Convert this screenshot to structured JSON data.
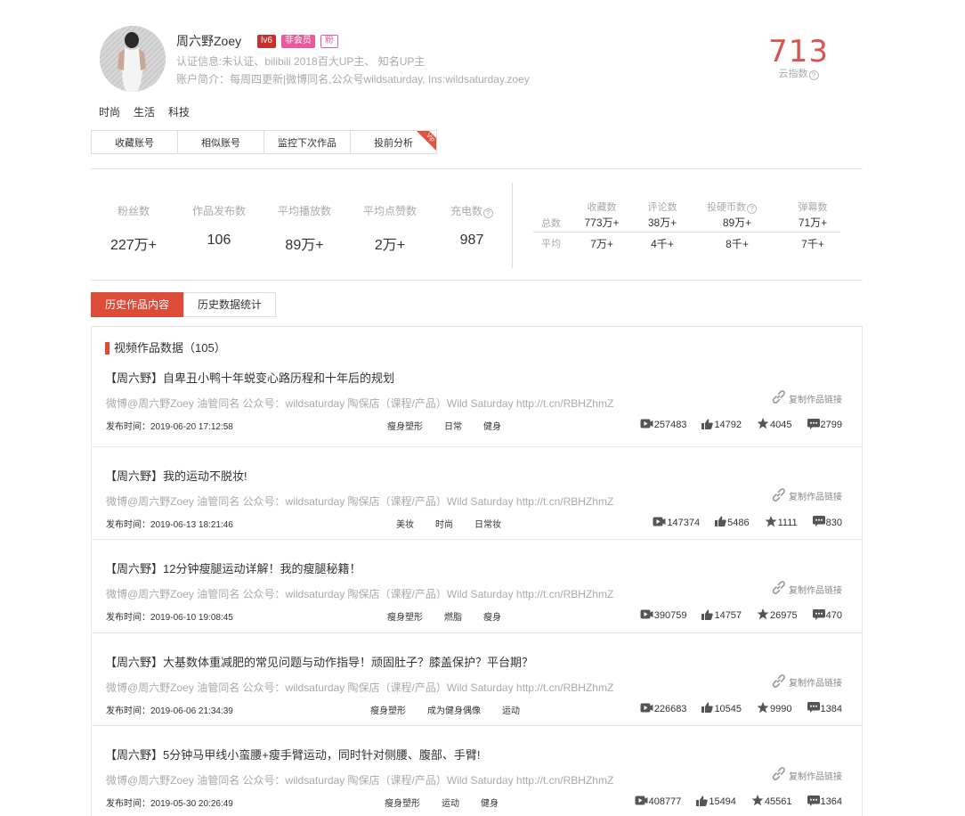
{
  "profile": {
    "name": "周六野Zoey",
    "badges": {
      "level": "lv6",
      "membership": "非会员",
      "fan": "粉"
    },
    "cert_info": "认证信息:未认证、bilibili 2018百大UP主、 知名UP主",
    "intro": "账户简介：每周四更新|微博同名,公众号wildsaturday, Ins:wildsaturday.zoey",
    "score": "713",
    "score_label": "云指数",
    "tags": [
      "时尚",
      "生活",
      "科技"
    ]
  },
  "actions": {
    "collect": "收藏账号",
    "similar": "相似账号",
    "monitor": "监控下次作品",
    "analysis": "投前分析",
    "vip_ribbon": "Vip"
  },
  "stats": {
    "fans": {
      "label": "粉丝数",
      "value": "227万+"
    },
    "works": {
      "label": "作品发布数",
      "value": "106"
    },
    "avg_play": {
      "label": "平均播放数",
      "value": "89万+"
    },
    "avg_like": {
      "label": "平均点赞数",
      "value": "2万+"
    },
    "charge": {
      "label": "充电数",
      "value": "987"
    }
  },
  "stat_grid": {
    "row_total": "总数",
    "row_avg": "平均",
    "headers": [
      "收藏数",
      "评论数",
      "投硬币数",
      "弹幕数"
    ],
    "total": [
      "773万+",
      "38万+",
      "89万+",
      "71万+"
    ],
    "avg": [
      "7万+",
      "4千+",
      "8千+",
      "7千+"
    ]
  },
  "tabs": {
    "history": "历史作品内容",
    "stats": "历史数据统计"
  },
  "list": {
    "title": "视频作品数据（105）",
    "copy_label": "复制作品链接",
    "date_prefix": "发布时间：",
    "items": [
      {
        "title": "【周六野】自卑丑小鸭十年蜕变心路历程和十年后的规划",
        "desc": "微博@周六野Zoey 油管同名 公众号：wildsaturday 陶保店（课程/产品）Wild Saturday http://t.cn/RBHZhmZ",
        "date": "2019-06-20 17:12:58",
        "tags": [
          "瘦身塑形",
          "日常",
          "健身"
        ],
        "plays": "257483",
        "likes": "14792",
        "coins": "4045",
        "comments": "2799"
      },
      {
        "title": "【周六野】我的运动不脱妆!",
        "desc": "微博@周六野Zoey 油管同名 公众号：wildsaturday 陶保店（课程/产品）Wild Saturday http://t.cn/RBHZhmZ",
        "date": "2019-06-13 18:21:46",
        "tags": [
          "美妆",
          "时尚",
          "日常妆"
        ],
        "plays": "147374",
        "likes": "5486",
        "coins": "1111",
        "comments": "830"
      },
      {
        "title": "【周六野】12分钟瘦腿运动详解！我的瘦腿秘籍！",
        "desc": "微博@周六野Zoey 油管同名 公众号：wildsaturday 陶保店（课程/产品）Wild Saturday http://t.cn/RBHZhmZ",
        "date": "2019-06-10 19:08:45",
        "tags": [
          "瘦身塑形",
          "燃脂",
          "瘦身"
        ],
        "plays": "390759",
        "likes": "14757",
        "coins": "26975",
        "comments": "470"
      },
      {
        "title": "【周六野】大基数体重减肥的常见问题与动作指导！顽固肚子？膝盖保护？平台期？",
        "desc": "微博@周六野Zoey 油管同名 公众号：wildsaturday 陶保店（课程/产品）Wild Saturday http://t.cn/RBHZhmZ",
        "date": "2019-06-06 21:34:39",
        "tags": [
          "瘦身塑形",
          "成为健身偶像",
          "运动"
        ],
        "plays": "226683",
        "likes": "10545",
        "coins": "9990",
        "comments": "1384"
      },
      {
        "title": "【周六野】5分钟马甲线小蛮腰+瘦手臂运动，同时针对侧腰、腹部、手臂!",
        "desc": "微博@周六野Zoey 油管同名 公众号：wildsaturday 陶保店（课程/产品）Wild Saturday http://t.cn/RBHZhmZ",
        "date": "2019-05-30 20:26:49",
        "tags": [
          "瘦身塑形",
          "运动",
          "健身"
        ],
        "plays": "408777",
        "likes": "15494",
        "coins": "45561",
        "comments": "1364"
      }
    ]
  }
}
